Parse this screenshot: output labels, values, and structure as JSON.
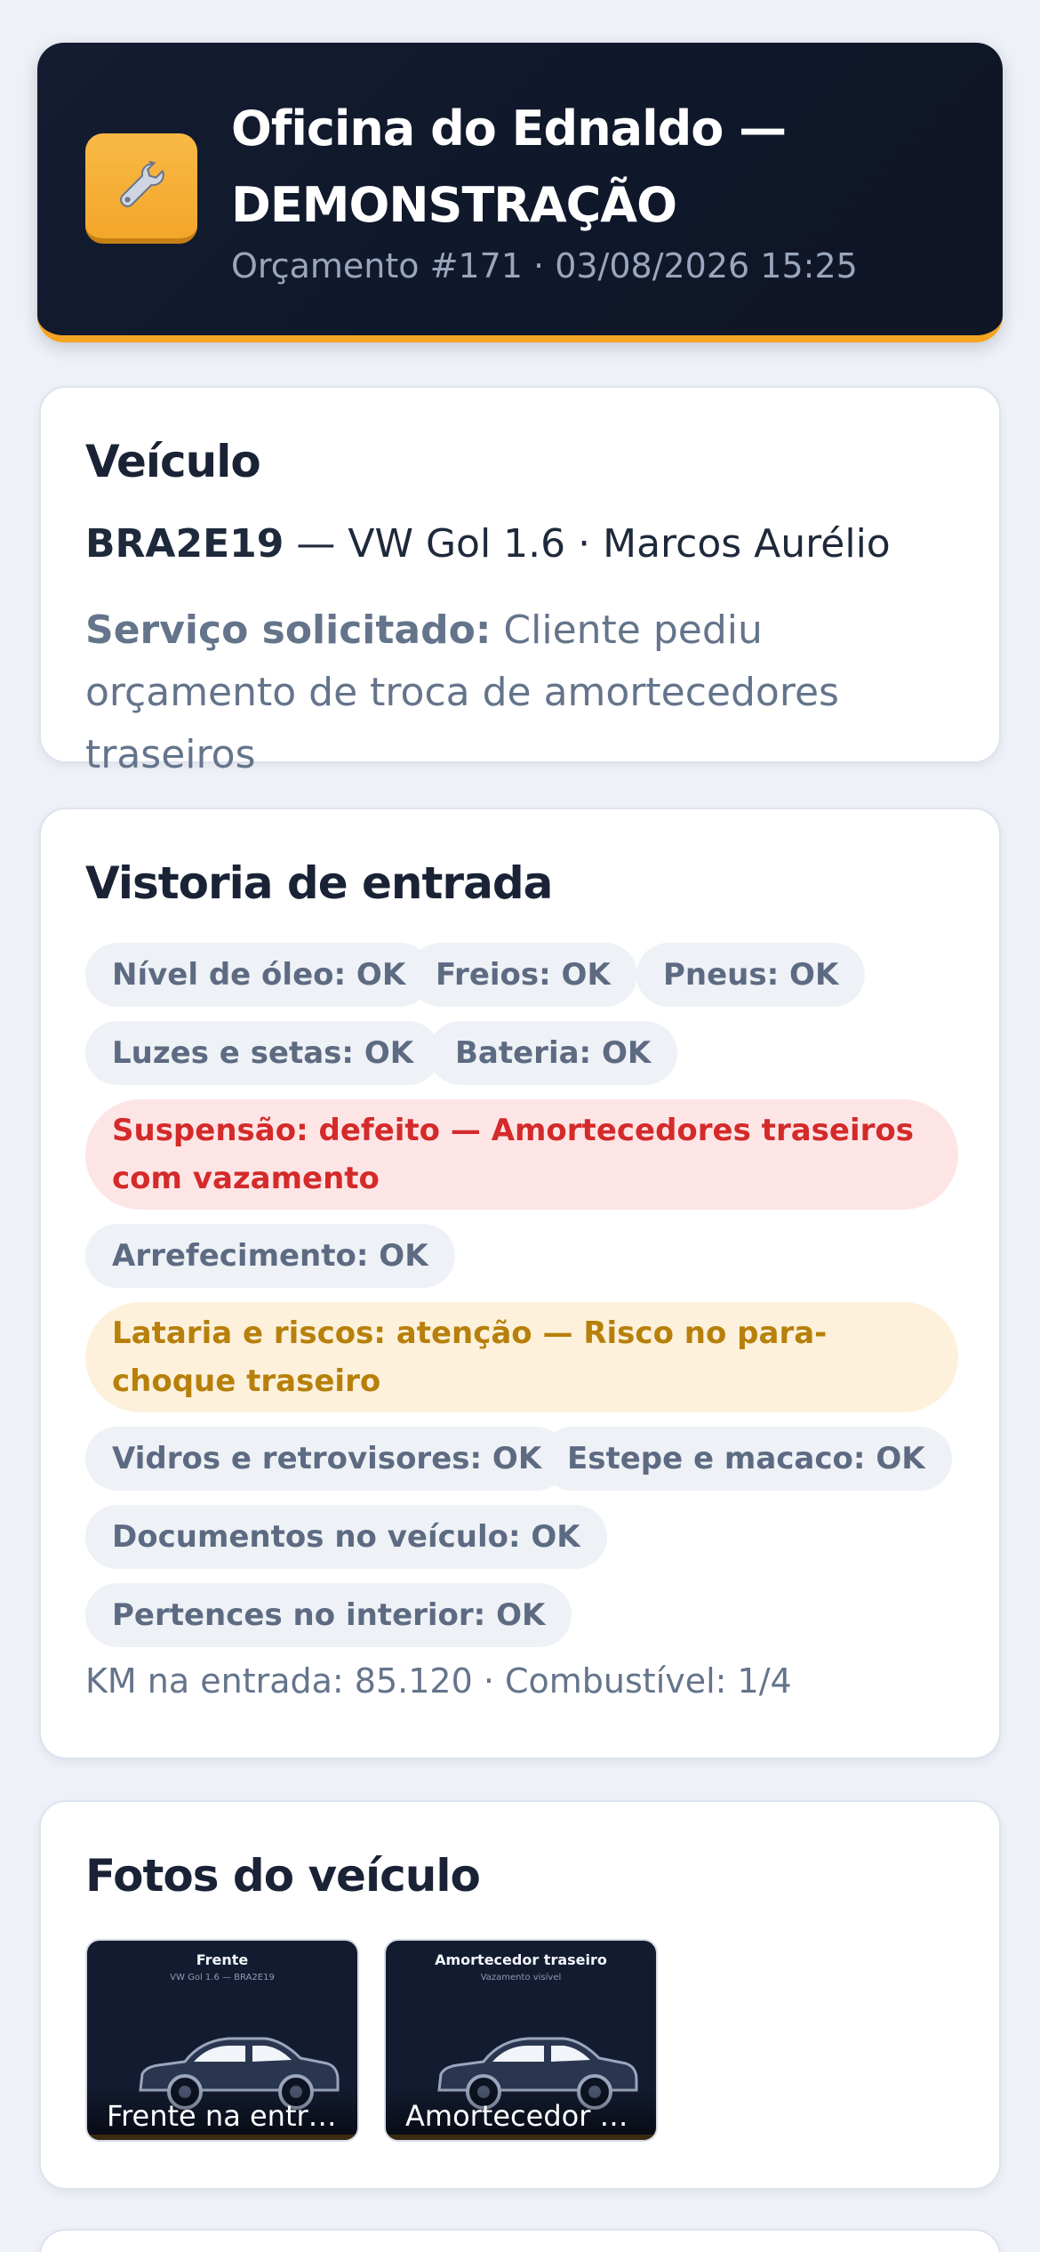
{
  "header": {
    "logo_icon": "wrench-icon",
    "title": "Oficina do Ednaldo — DEMONSTRAÇÃO",
    "subtitle": "Orçamento #171 · 03/08/2026 15:25",
    "accent": "#f5a524"
  },
  "vehicle": {
    "title": "Veículo",
    "plate": "BRA2E19",
    "details": " — VW Gol 1.6 · Marcos Aurélio",
    "service_label": "Serviço solicitado:",
    "service_text": " Cliente pediu orçamento de troca de amortecedores traseiros"
  },
  "inspection": {
    "title": "Vistoria de entrada",
    "items": [
      {
        "label": "Nível de óleo: OK",
        "status": "ok"
      },
      {
        "label": "Freios: OK",
        "status": "ok"
      },
      {
        "label": "Pneus: OK",
        "status": "ok"
      },
      {
        "label": "Luzes e setas: OK",
        "status": "ok"
      },
      {
        "label": "Bateria: OK",
        "status": "ok"
      },
      {
        "label": "Suspensão: defeito — Amortecedores traseiros com vazamento",
        "status": "defect"
      },
      {
        "label": "Arrefecimento: OK",
        "status": "ok"
      },
      {
        "label": "Lataria e riscos: atenção — Risco no para-choque traseiro",
        "status": "warn"
      },
      {
        "label": "Vidros e retrovisores: OK",
        "status": "ok"
      },
      {
        "label": "Estepe e macaco: OK",
        "status": "ok"
      },
      {
        "label": "Documentos no veículo: OK",
        "status": "ok"
      },
      {
        "label": "Pertences no interior: OK",
        "status": "ok"
      }
    ],
    "km_fuel": "KM na entrada: 85.120 · Combustível: 1/4",
    "colors": {
      "defect": "#d42a2a",
      "warn": "#b7800a",
      "ok": "#5d6b82"
    }
  },
  "photos": {
    "title": "Fotos do veículo",
    "items": [
      {
        "image_title": "Frente",
        "image_subtitle": "VW Gol 1.6 — BRA2E19",
        "caption": "Frente na entrada"
      },
      {
        "image_title": "Amortecedor traseiro",
        "image_subtitle": "Vazamento visível",
        "caption": "Amortecedor c…"
      }
    ]
  }
}
